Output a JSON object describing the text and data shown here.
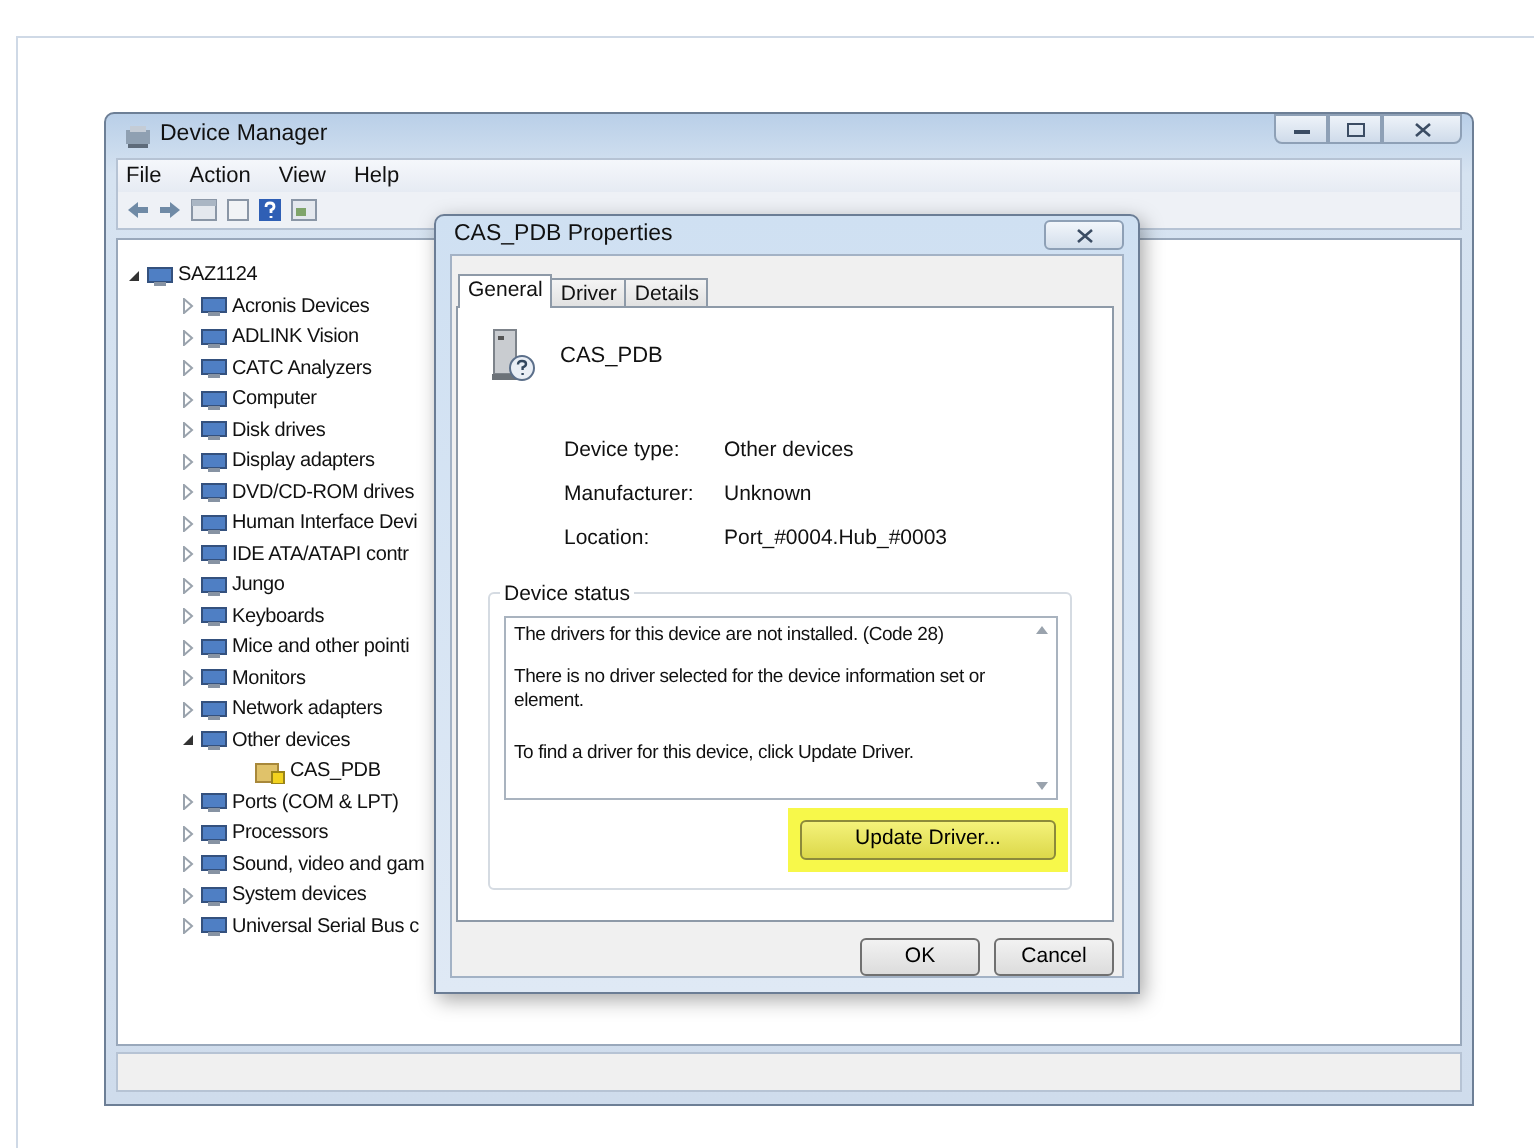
{
  "window": {
    "title": "Device Manager",
    "menu": [
      "File",
      "Action",
      "View",
      "Help"
    ]
  },
  "tree": [
    {
      "label": "SAZ1124",
      "expanded": true,
      "children": [
        {
          "label": "Acronis Devices",
          "expanded": false
        },
        {
          "label": "ADLINK Vision",
          "expanded": false
        },
        {
          "label": "CATC Analyzers",
          "expanded": false
        },
        {
          "label": "Computer",
          "expanded": false
        },
        {
          "label": "Disk drives",
          "expanded": false
        },
        {
          "label": "Display adapters",
          "expanded": false
        },
        {
          "label": "DVD/CD-ROM drives",
          "expanded": false
        },
        {
          "label": "Human Interface Devi",
          "expanded": false
        },
        {
          "label": "IDE ATA/ATAPI contr",
          "expanded": false
        },
        {
          "label": "Jungo",
          "expanded": false
        },
        {
          "label": "Keyboards",
          "expanded": false
        },
        {
          "label": "Mice and other pointi",
          "expanded": false
        },
        {
          "label": "Monitors",
          "expanded": false
        },
        {
          "label": "Network adapters",
          "expanded": false
        },
        {
          "label": "Other devices",
          "expanded": true,
          "children": [
            {
              "label": "CAS_PDB"
            }
          ]
        },
        {
          "label": "Ports (COM & LPT)",
          "expanded": false
        },
        {
          "label": "Processors",
          "expanded": false
        },
        {
          "label": "Sound, video and gam",
          "expanded": false
        },
        {
          "label": "System devices",
          "expanded": false
        },
        {
          "label": "Universal Serial Bus c",
          "expanded": false
        }
      ]
    }
  ],
  "dialog": {
    "title": "CAS_PDB Properties",
    "tabs": [
      {
        "label": "General",
        "selected": true
      },
      {
        "label": "Driver",
        "selected": false
      },
      {
        "label": "Details",
        "selected": false
      }
    ],
    "device_name": "CAS_PDB",
    "properties": [
      {
        "label": "Device type:",
        "value": "Other devices"
      },
      {
        "label": "Manufacturer:",
        "value": "Unknown"
      },
      {
        "label": "Location:",
        "value": "Port_#0004.Hub_#0003"
      }
    ],
    "status_group": "Device status",
    "status_lines": [
      "The drivers for this device are not installed. (Code 28)",
      "There is no driver selected for the device information set or element.",
      "To find a driver for this device, click Update Driver."
    ],
    "update_button": {
      "label": "Update Driver...",
      "highlighted": true
    },
    "buttons": [
      "OK",
      "Cancel"
    ]
  }
}
